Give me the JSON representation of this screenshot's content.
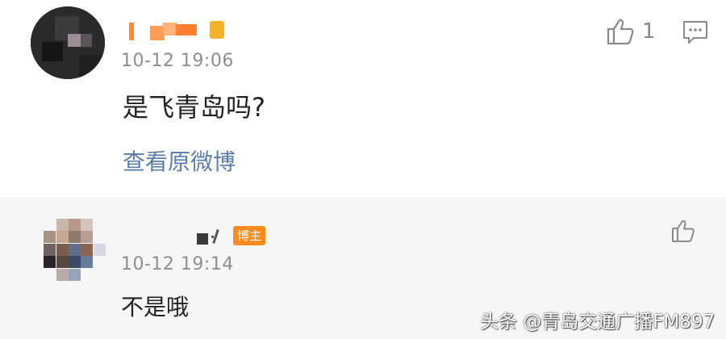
{
  "comments": [
    {
      "username_obscured": true,
      "time": "10-12 19:06",
      "text": "是飞青岛吗?",
      "like_count": "1",
      "view_original_label": "查看原微博",
      "icons": [
        "like-icon",
        "reply-icon"
      ]
    },
    {
      "username_obscured": true,
      "author_badge": "博主",
      "time": "10-12 19:14",
      "text": "不是哦",
      "icons": [
        "like-icon"
      ]
    }
  ],
  "watermark": "头条 @青岛交通广播FM897",
  "colors": {
    "timestamp": "#8e8e8e",
    "link": "#5d7ea8",
    "badge": "#ff8a1e",
    "reply_background": "#f6f6f6"
  }
}
